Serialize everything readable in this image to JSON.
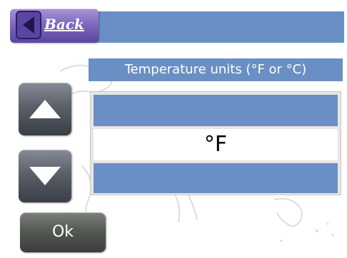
{
  "header": {
    "back_label": "Back",
    "back_icon": "left-arrow-icon"
  },
  "setting": {
    "title": "Temperature units (°F or °C)",
    "current_value": "°F",
    "previous_value": "",
    "next_value": ""
  },
  "controls": {
    "up_icon": "up-arrow-icon",
    "down_icon": "down-arrow-icon",
    "ok_label": "Ok"
  },
  "colors": {
    "bar_blue": "#6a8fc4",
    "back_purple": "#7f68bf",
    "button_gray": "#5b6069"
  }
}
